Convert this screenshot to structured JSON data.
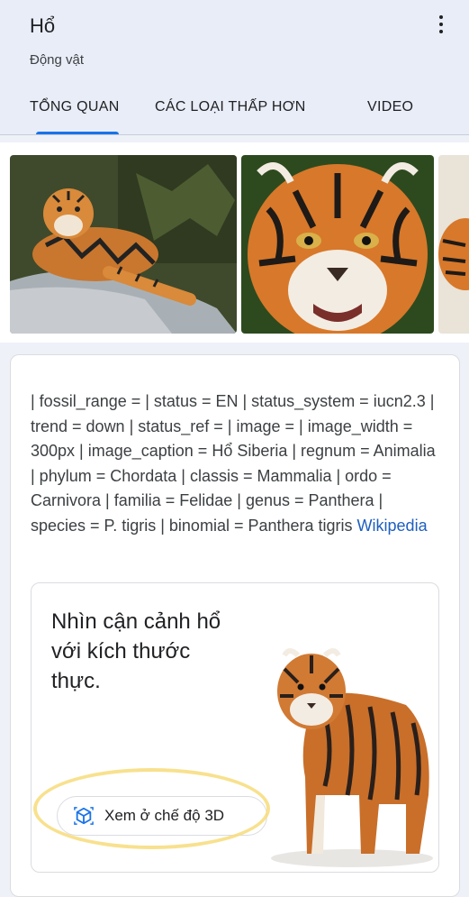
{
  "header": {
    "title": "Hổ",
    "subtitle": "Động vật",
    "tabs": [
      {
        "label": "TỔNG QUAN",
        "active": true
      },
      {
        "label": "CÁC LOẠI THẤP HƠN",
        "active": false
      },
      {
        "label": "VIDEO",
        "active": false
      }
    ],
    "menu_icon": "more-vert-icon"
  },
  "gallery": {
    "images": [
      "tiger-resting-on-rock",
      "tiger-face-closeup",
      "tiger-partial"
    ]
  },
  "description": {
    "text": "| fossil_range = | status = EN | status_system = iucn2.3 | trend = down | status_ref = | image = | image_width = 300px | image_caption = Hổ Siberia | regnum = Animalia | phylum = Chordata | classis = Mammalia | ordo = Carnivora | familia = Felidae | genus = Panthera | species = P. tigris | binomial = Panthera tigris",
    "source_link": "Wikipedia"
  },
  "ar_card": {
    "text": "Nhìn cận cảnh hổ với kích thước thực.",
    "button_label": "Xem ở chế độ 3D",
    "button_icon": "ar-cube-icon"
  },
  "colors": {
    "accent": "#1a73e8",
    "link": "#1f5fbf",
    "header_bg": "#e9edf7",
    "highlight": "#f7dc7a"
  }
}
